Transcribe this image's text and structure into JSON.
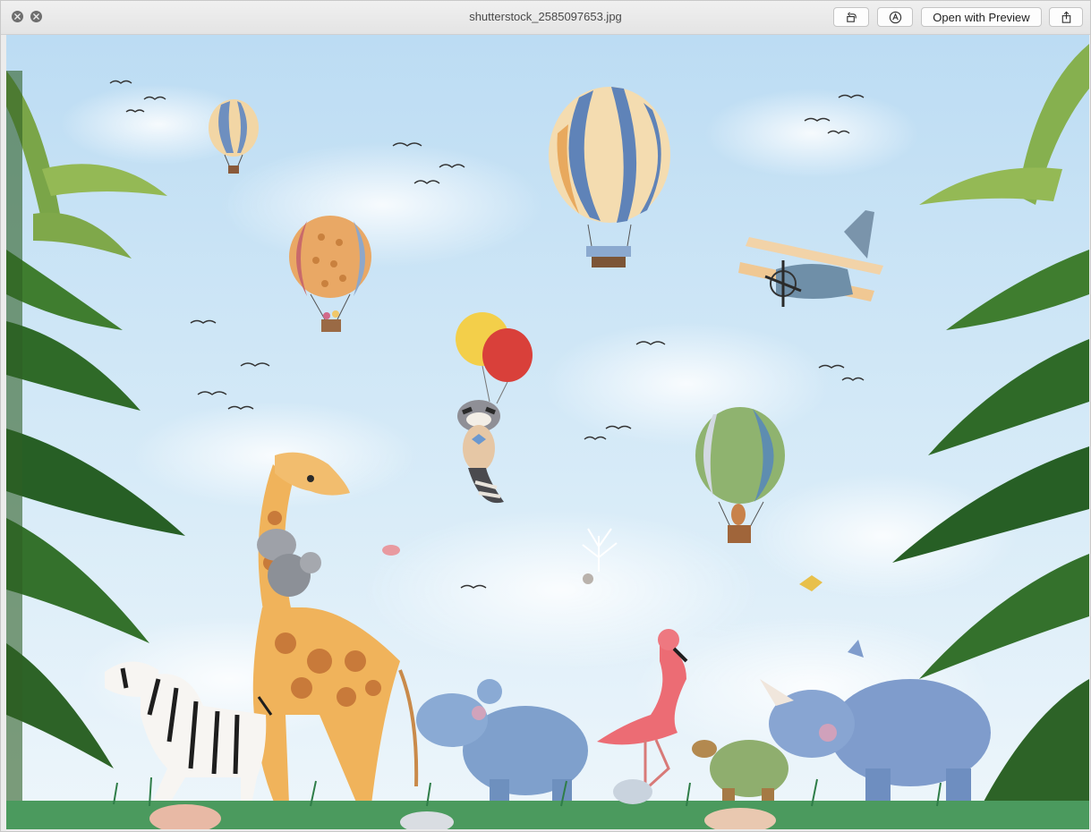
{
  "window": {
    "title": "shutterstock_2585097653.jpg"
  },
  "toolbar": {
    "rotate_icon": "rotate-left-icon",
    "markup_icon": "markup-pen-icon",
    "open_with_label": "Open with Preview",
    "share_icon": "share-icon"
  },
  "traffic_lights": {
    "close_icon": "close-icon",
    "fullscreen_icon": "fullscreen-icon"
  },
  "image": {
    "subject": "watercolor safari nursery scene"
  },
  "colors": {
    "sky": "#cfe6f6",
    "grass": "#3f8f5a",
    "titlebar": "#e8e8e8"
  }
}
